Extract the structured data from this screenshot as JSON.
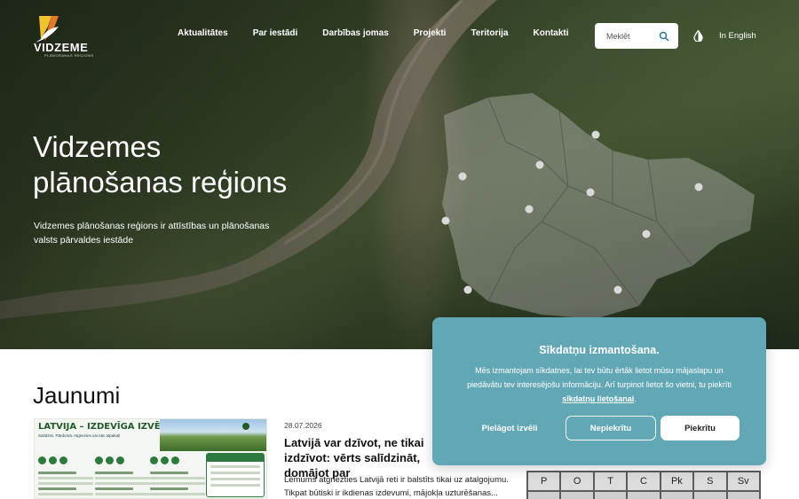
{
  "header": {
    "logo_text": "VIDZEME",
    "logo_sub": "PLĀNOŠANAS REĢIONS",
    "nav": [
      {
        "label": "Aktualitātes"
      },
      {
        "label": "Par iestādi"
      },
      {
        "label": "Darbības jomas"
      },
      {
        "label": "Projekti"
      },
      {
        "label": "Teritorija"
      },
      {
        "label": "Kontakti"
      }
    ],
    "search_placeholder": "Meklēt",
    "language": "In English"
  },
  "hero": {
    "title_line1": "Vidzemes",
    "title_line2": "plānošanas reģions",
    "description": "Vidzemes plānošanas reģions ir attīstības un plānošanas valsts pārvaldes iestāde"
  },
  "news": {
    "section_title": "Jaunumi",
    "image_title": "LATVIJA – IZDEVĪGA IZVĒLE DZĪVEI!",
    "image_subtitle": "Salīdzini. Pārdomā. Atgriezies vai nāc atpakaļ!",
    "date": "28.07.2026",
    "headline": "Latvijā var dzīvot, ne tikai izdzīvot: vērts salīdzināt, domājot par",
    "excerpt": "Lēmums atgriezties Latvijā reti ir balstīts tikai uz atalgojumu. Tikpat būtiski ir ikdienas izdevumi, mājokļa uzturēšanas..."
  },
  "calendar": {
    "days": [
      "P",
      "O",
      "T",
      "C",
      "Pk",
      "S",
      "Sv"
    ]
  },
  "cookie": {
    "title": "Sīkdatņu izmantošana.",
    "text_before": "Mēs izmantojam sīkdatnes, lai tev būtu ērtāk lietot mūsu mājaslapu un piedāvātu tev interesējošu informāciju. Arī turpinot lietot šo vietni, tu piekrīti ",
    "link": "sīkdatņu lietošanai",
    "text_after": ".",
    "customize": "Pielāgot izvēli",
    "decline": "Nepiekrītu",
    "accept": "Piekrītu"
  },
  "colors": {
    "cookie_bg": "#62a7b6",
    "text_dark": "#111111",
    "white": "#ffffff"
  }
}
